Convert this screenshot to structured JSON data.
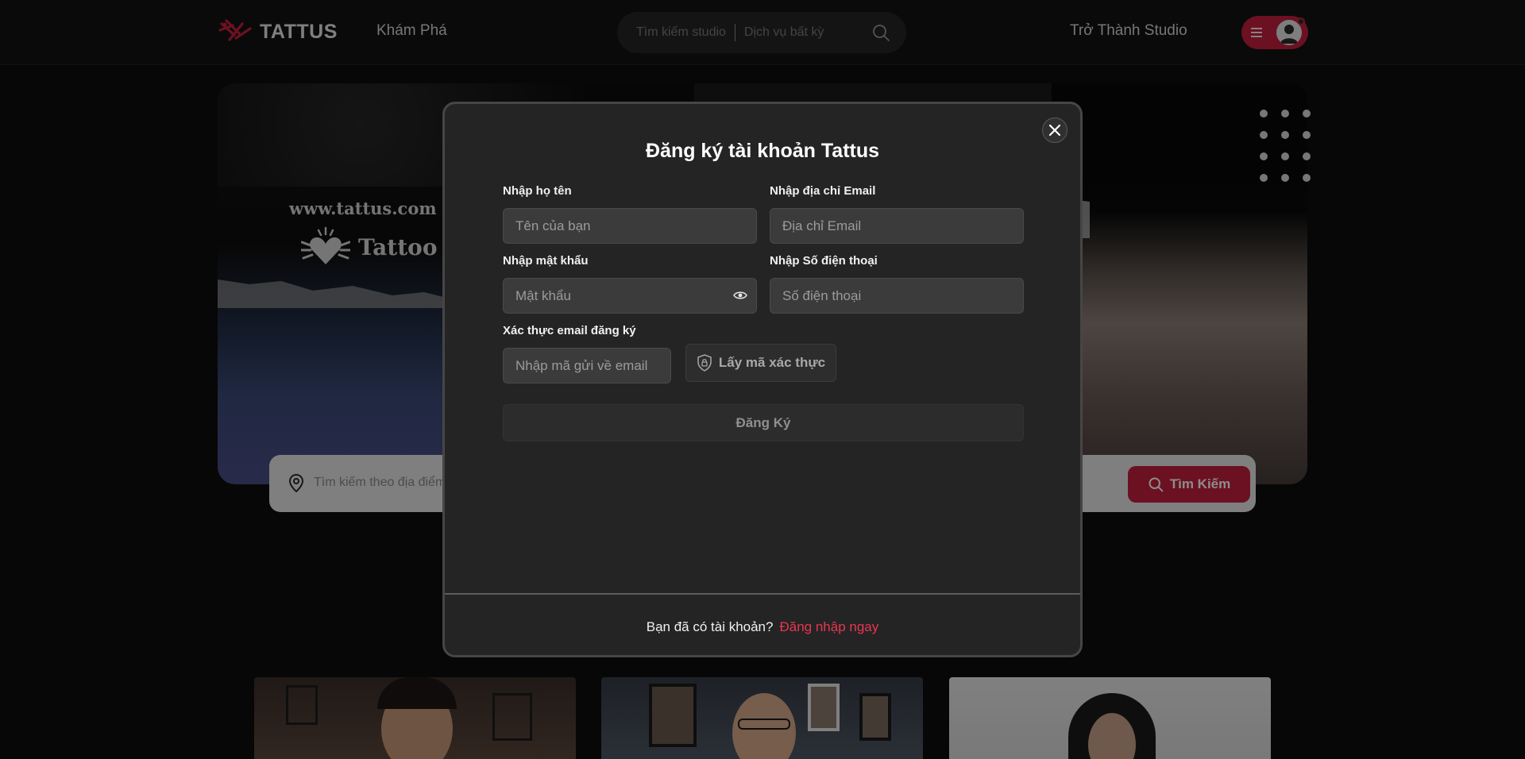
{
  "header": {
    "logo_text": "TATTUS",
    "nav_explore": "Khám Phá",
    "search": {
      "studio_placeholder": "Tìm kiếm studio",
      "service_placeholder": "Dịch vụ bất kỳ"
    },
    "become_studio": "Trở Thành Studio"
  },
  "hero": {
    "site_url": "www.tattus.com",
    "brand_text": "Tattoo",
    "search_placeholder": "Tìm kiếm theo địa điểm",
    "search_button": "Tìm Kiếm"
  },
  "modal": {
    "title": "Đăng ký tài khoản Tattus",
    "fields": {
      "name": {
        "label": "Nhập họ tên",
        "placeholder": "Tên của bạn"
      },
      "email": {
        "label": "Nhập địa chỉ Email",
        "placeholder": "Địa chỉ Email"
      },
      "password": {
        "label": "Nhập mật khẩu",
        "placeholder": "Mật khẩu"
      },
      "phone": {
        "label": "Nhập Số điện thoại",
        "placeholder": "Số điện thoại"
      },
      "verify": {
        "label": "Xác thực email đăng ký",
        "placeholder": "Nhập mã gửi về email"
      }
    },
    "get_code_button": "Lấy mã xác thực",
    "submit_button": "Đăng Ký",
    "footer_text": "Bạn đã có tài khoản?",
    "login_link": "Đăng nhập ngay"
  },
  "colors": {
    "accent": "#c3203f",
    "link": "#e8364f",
    "modal_bg": "#242425",
    "page_bg": "#0d0d0d"
  },
  "icons": [
    "tattus-logo-icon",
    "search-icon",
    "menu-icon",
    "user-avatar-icon",
    "location-pin-icon",
    "close-icon",
    "eye-icon",
    "shield-lock-icon",
    "heart-wings-icon"
  ]
}
